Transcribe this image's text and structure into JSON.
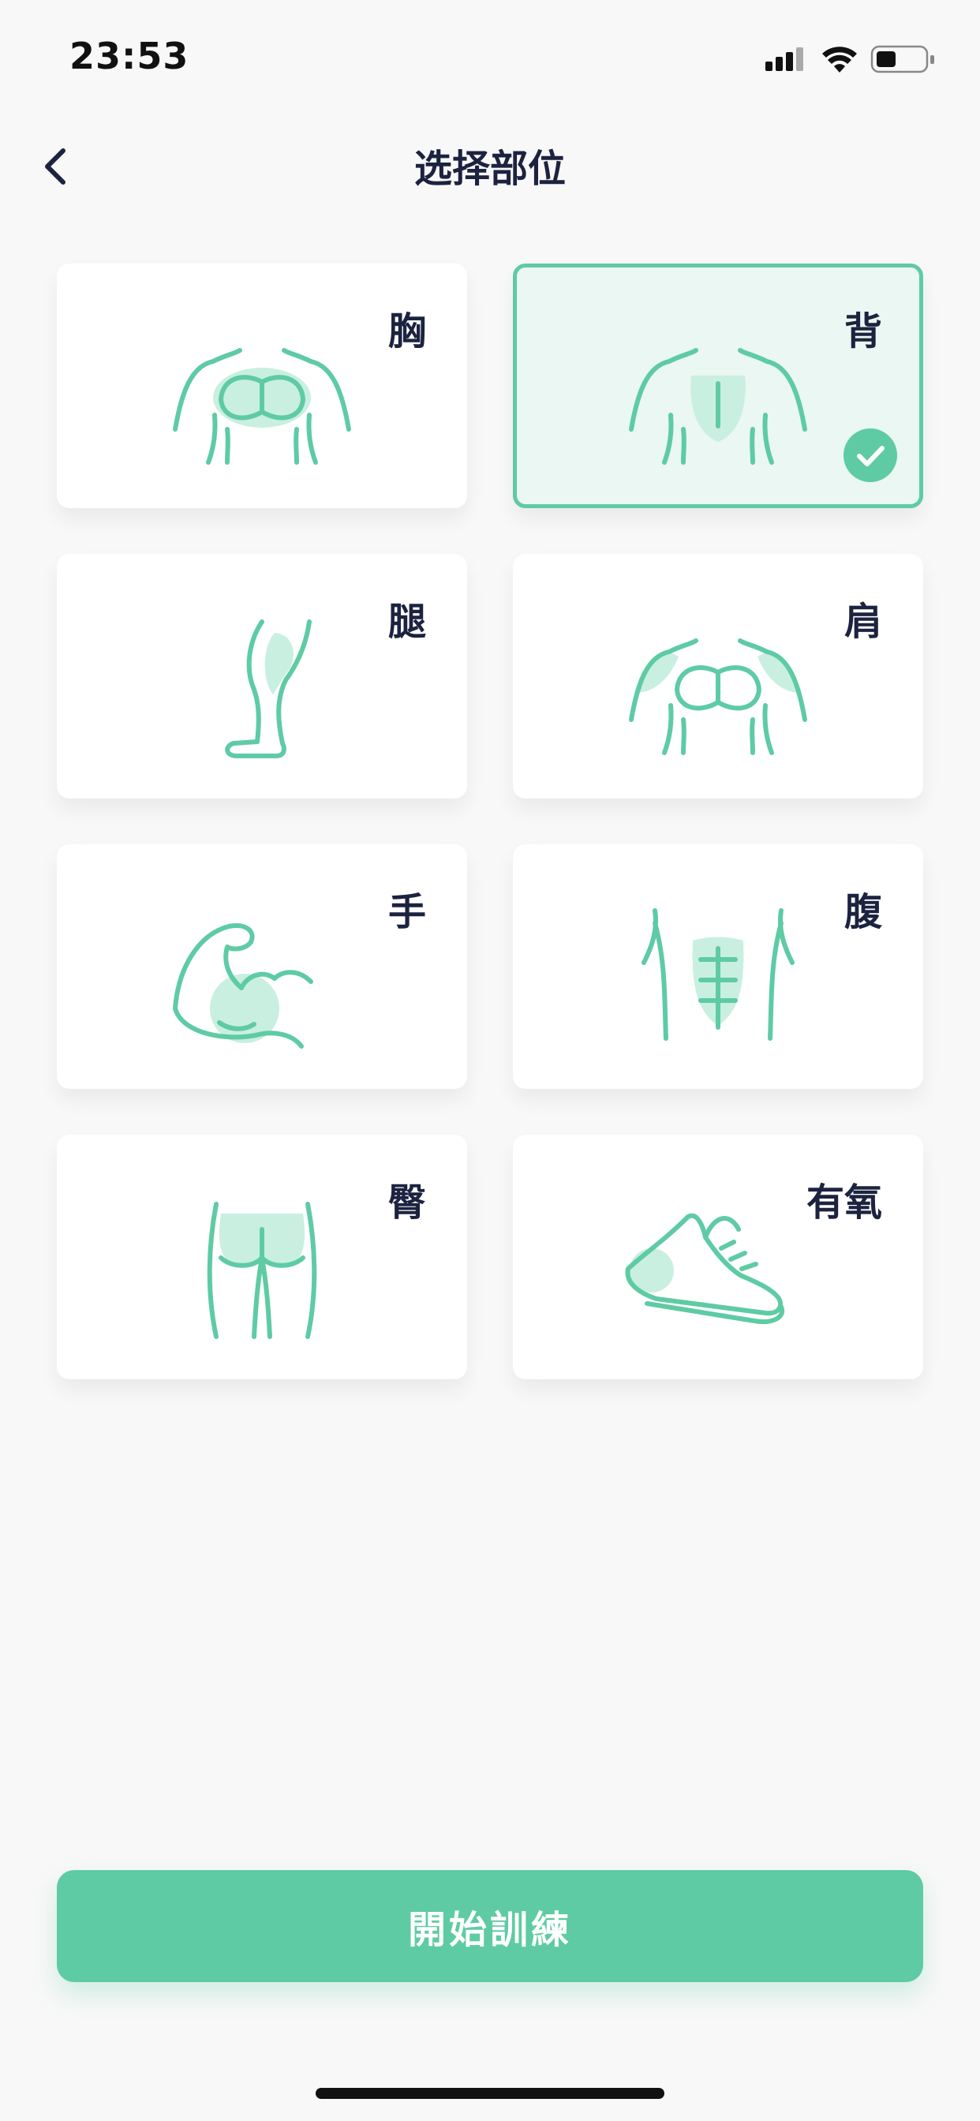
{
  "status_bar": {
    "time": "23:53"
  },
  "header": {
    "title": "选择部位"
  },
  "body_parts": [
    {
      "label": "胸",
      "icon": "chest-icon",
      "selected": false
    },
    {
      "label": "背",
      "icon": "back-muscle-icon",
      "selected": true
    },
    {
      "label": "腿",
      "icon": "leg-icon",
      "selected": false
    },
    {
      "label": "肩",
      "icon": "shoulder-icon",
      "selected": false
    },
    {
      "label": "手",
      "icon": "arm-icon",
      "selected": false
    },
    {
      "label": "腹",
      "icon": "abs-icon",
      "selected": false
    },
    {
      "label": "臀",
      "icon": "glutes-icon",
      "selected": false
    },
    {
      "label": "有氧",
      "icon": "sneaker-icon",
      "selected": false
    }
  ],
  "actions": {
    "start_label": "開始訓練"
  },
  "colors": {
    "accent": "#5ecba4",
    "accent_light": "#c9efe1",
    "selected_bg": "#eaf7f2",
    "text": "#1c2340",
    "background": "#f8f8f8"
  }
}
